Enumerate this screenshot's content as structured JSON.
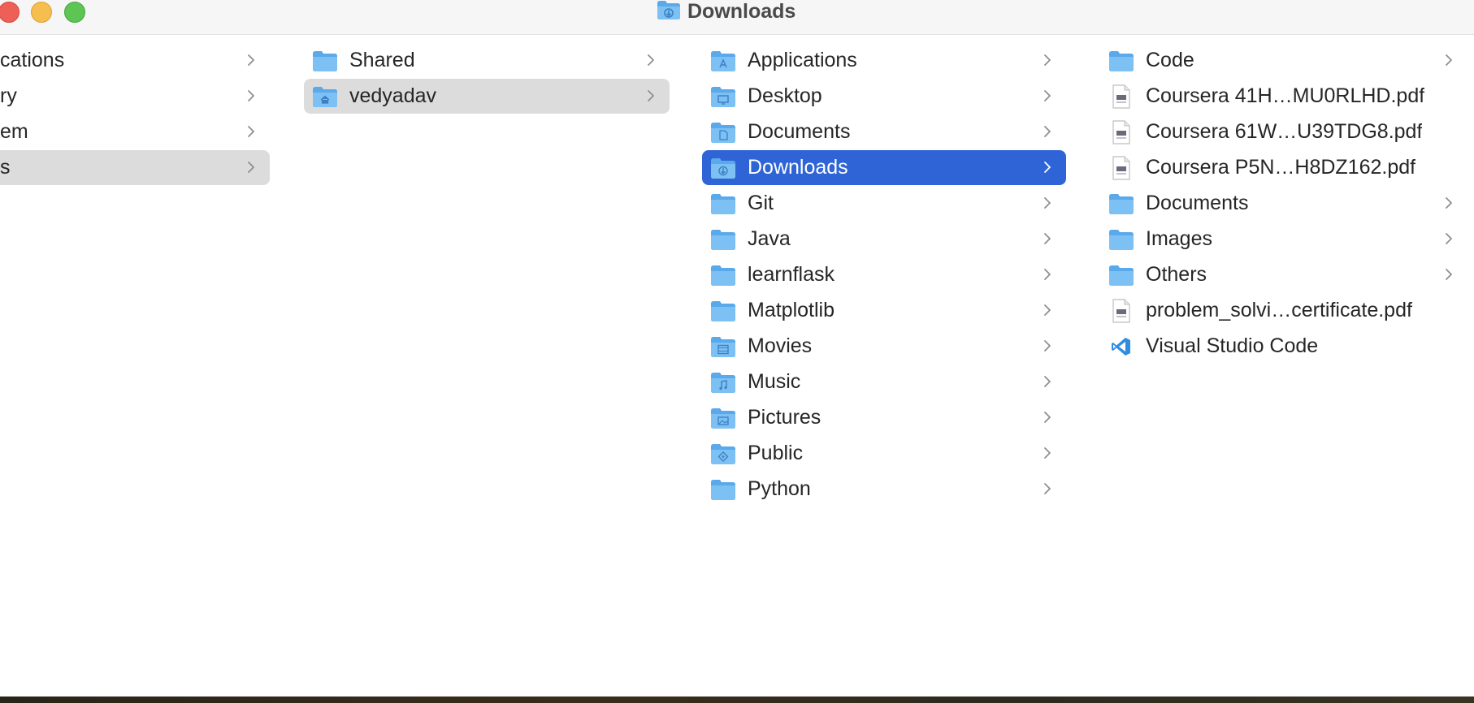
{
  "window": {
    "title": "Downloads",
    "title_icon": "downloads-folder-icon"
  },
  "colors": {
    "selection_blue": "#2e64d6",
    "selection_gray": "#dcdcdc",
    "folder_blue": "#6cb4ee"
  },
  "columns": [
    {
      "items": [
        {
          "label": "cations",
          "icon": "none",
          "chevron": true,
          "selected": false
        },
        {
          "label": "ry",
          "icon": "none",
          "chevron": true,
          "selected": false
        },
        {
          "label": "em",
          "icon": "none",
          "chevron": true,
          "selected": false
        },
        {
          "label": "s",
          "icon": "none",
          "chevron": true,
          "selected": "gray"
        }
      ]
    },
    {
      "items": [
        {
          "label": "Shared",
          "icon": "folder-icon",
          "chevron": true,
          "selected": false
        },
        {
          "label": "vedyadav",
          "icon": "home-folder-icon",
          "chevron": true,
          "selected": "gray"
        }
      ]
    },
    {
      "items": [
        {
          "label": "Applications",
          "icon": "applications-folder-icon",
          "chevron": true,
          "selected": false
        },
        {
          "label": "Desktop",
          "icon": "desktop-folder-icon",
          "chevron": true,
          "selected": false
        },
        {
          "label": "Documents",
          "icon": "documents-folder-icon",
          "chevron": true,
          "selected": false
        },
        {
          "label": "Downloads",
          "icon": "downloads-folder-icon",
          "chevron": true,
          "selected": "blue"
        },
        {
          "label": "Git",
          "icon": "folder-icon",
          "chevron": true,
          "selected": false
        },
        {
          "label": "Java",
          "icon": "folder-icon",
          "chevron": true,
          "selected": false
        },
        {
          "label": "learnflask",
          "icon": "folder-icon",
          "chevron": true,
          "selected": false
        },
        {
          "label": "Matplotlib",
          "icon": "folder-icon",
          "chevron": true,
          "selected": false
        },
        {
          "label": "Movies",
          "icon": "movies-folder-icon",
          "chevron": true,
          "selected": false
        },
        {
          "label": "Music",
          "icon": "music-folder-icon",
          "chevron": true,
          "selected": false
        },
        {
          "label": "Pictures",
          "icon": "pictures-folder-icon",
          "chevron": true,
          "selected": false
        },
        {
          "label": "Public",
          "icon": "public-folder-icon",
          "chevron": true,
          "selected": false
        },
        {
          "label": "Python",
          "icon": "folder-icon",
          "chevron": true,
          "selected": false
        }
      ]
    },
    {
      "items": [
        {
          "label": "Code",
          "icon": "folder-icon",
          "chevron": true,
          "selected": false
        },
        {
          "label": "Coursera 41H…MU0RLHD.pdf",
          "icon": "pdf-file-icon",
          "chevron": false,
          "selected": false
        },
        {
          "label": "Coursera 61W…U39TDG8.pdf",
          "icon": "pdf-file-icon",
          "chevron": false,
          "selected": false
        },
        {
          "label": "Coursera P5N…H8DZ162.pdf",
          "icon": "pdf-file-icon",
          "chevron": false,
          "selected": false
        },
        {
          "label": "Documents",
          "icon": "folder-icon",
          "chevron": true,
          "selected": false
        },
        {
          "label": "Images",
          "icon": "folder-icon",
          "chevron": true,
          "selected": false
        },
        {
          "label": "Others",
          "icon": "folder-icon",
          "chevron": true,
          "selected": false
        },
        {
          "label": "problem_solvi…certificate.pdf",
          "icon": "pdf-file-icon",
          "chevron": false,
          "selected": false
        },
        {
          "label": "Visual Studio Code",
          "icon": "vscode-app-icon",
          "chevron": false,
          "selected": false
        }
      ]
    }
  ]
}
